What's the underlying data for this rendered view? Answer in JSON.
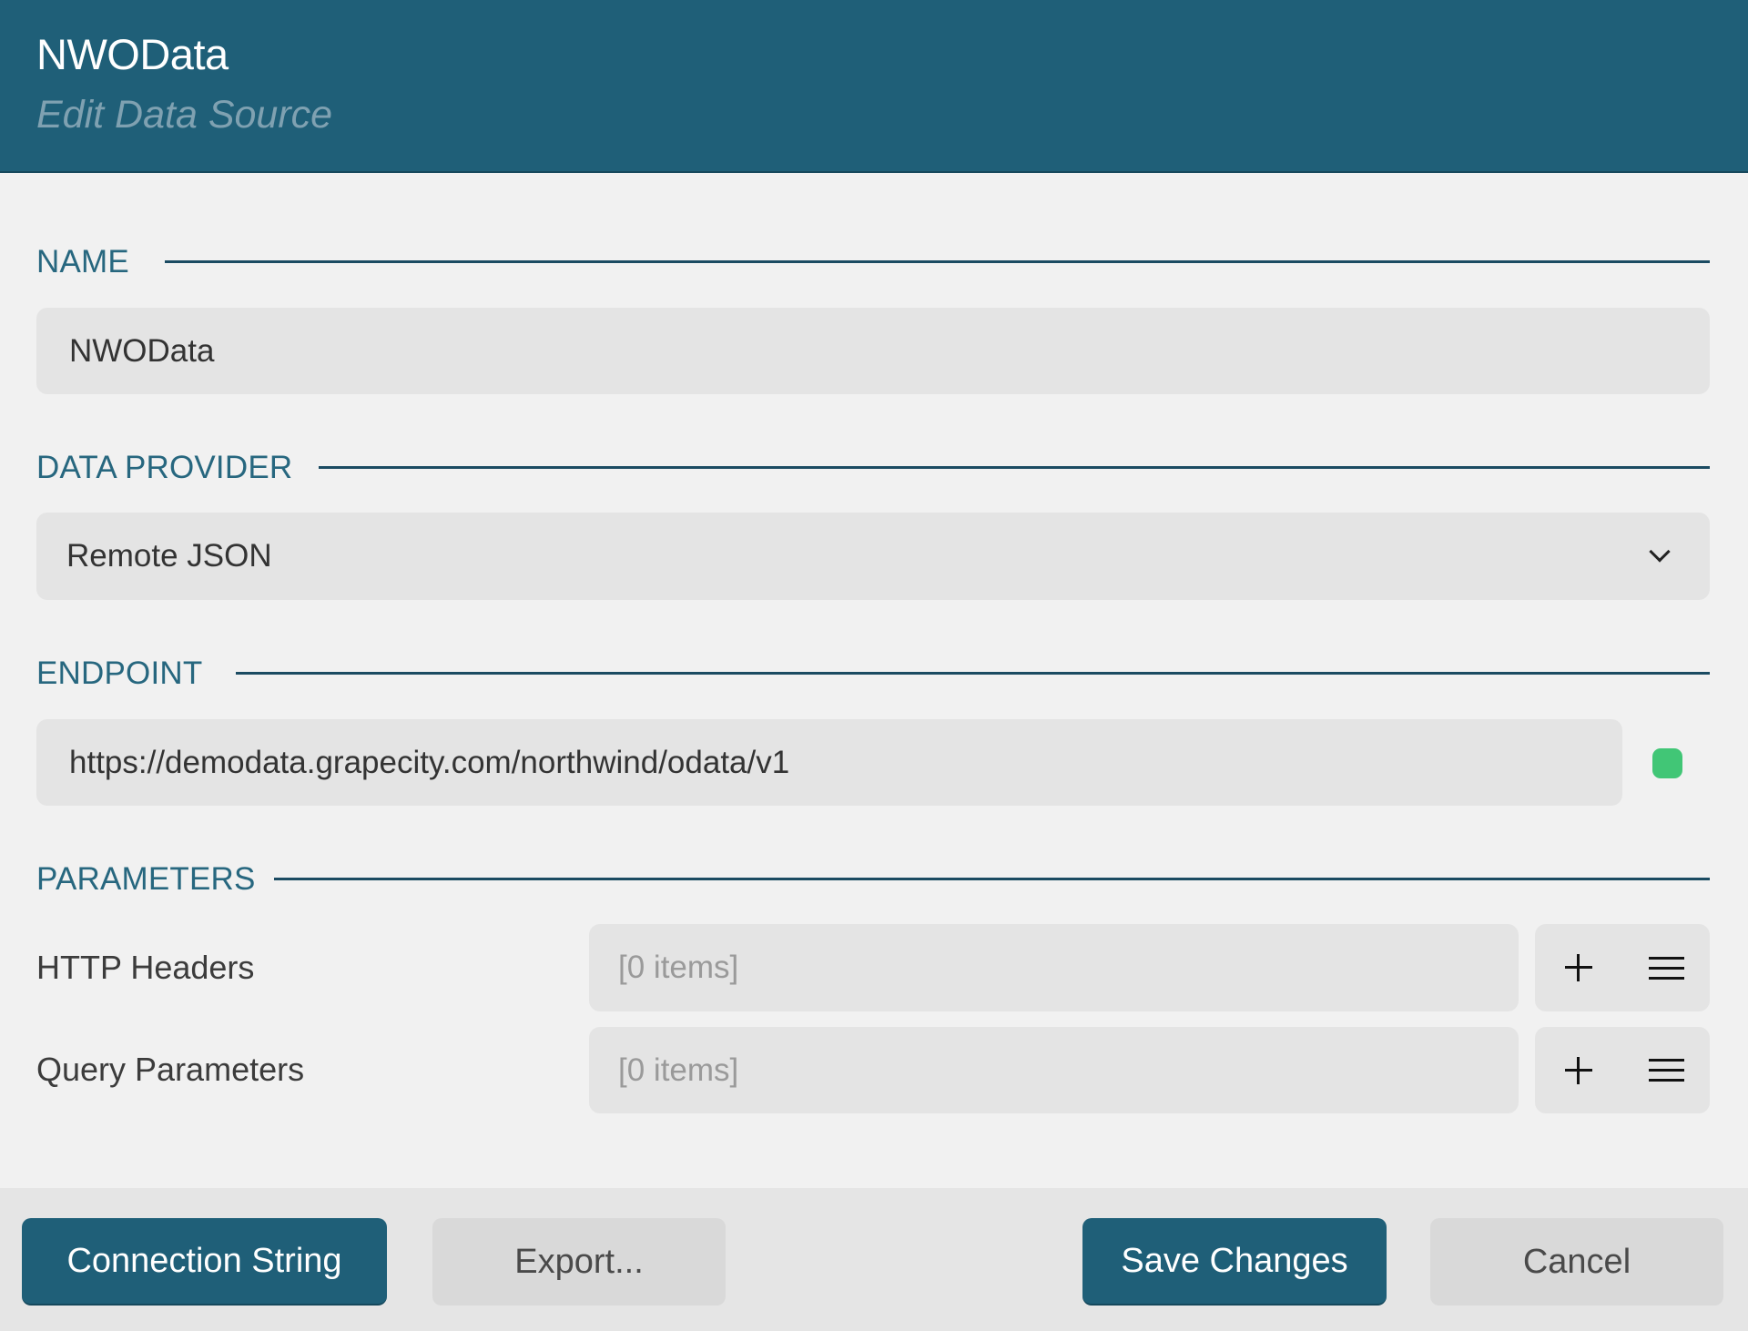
{
  "header": {
    "title": "NWOData",
    "subtitle": "Edit Data Source"
  },
  "sections": {
    "name": {
      "label": "NAME",
      "value": "NWOData"
    },
    "data_provider": {
      "label": "DATA PROVIDER",
      "selected": "Remote JSON",
      "icon": "chevron-down-icon"
    },
    "endpoint": {
      "label": "ENDPOINT",
      "value": "https://demodata.grapecity.com/northwind/odata/v1",
      "status": "connected",
      "status_color": "#41c676"
    },
    "parameters": {
      "label": "PARAMETERS",
      "rows": [
        {
          "label": "HTTP Headers",
          "value": "[0 items]",
          "add_icon": "plus-icon",
          "edit_icon": "menu-icon"
        },
        {
          "label": "Query Parameters",
          "value": "[0 items]",
          "add_icon": "plus-icon",
          "edit_icon": "menu-icon"
        }
      ]
    }
  },
  "footer": {
    "connection_string_label": "Connection String",
    "export_label": "Export...",
    "save_label": "Save Changes",
    "cancel_label": "Cancel"
  },
  "colors": {
    "accent": "#1f5f78",
    "section_label": "#27677f",
    "status_ok": "#41c676"
  }
}
